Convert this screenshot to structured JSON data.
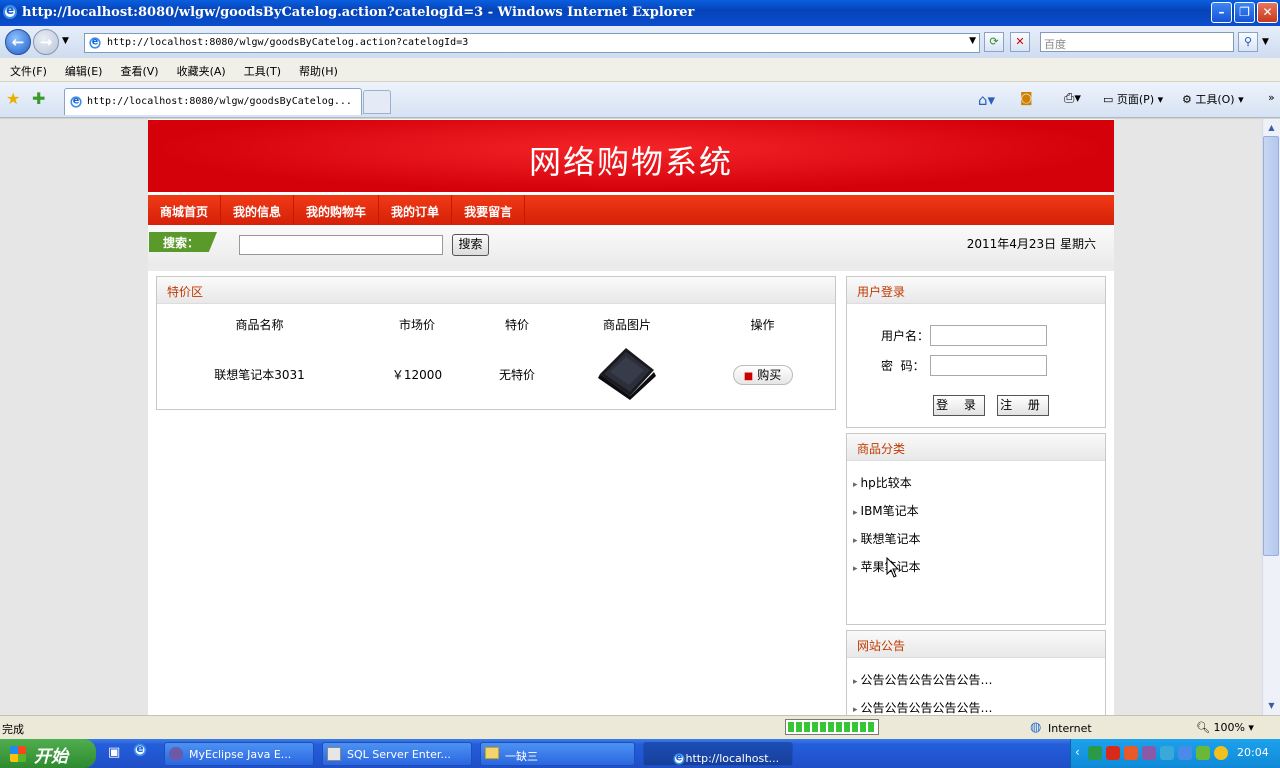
{
  "window": {
    "title": "http://localhost:8080/wlgw/goodsByCatelog.action?catelogId=3 - Windows Internet Explorer",
    "url": "http://localhost:8080/wlgw/goodsByCatelog.action?catelogId=3",
    "search_placeholder": "百度",
    "tab_title": "http://localhost:8080/wlgw/goodsByCatelog...",
    "menu": [
      "文件(F)",
      "编辑(E)",
      "查看(V)",
      "收藏夹(A)",
      "工具(T)",
      "帮助(H)"
    ],
    "tools": {
      "page": "页面(P)",
      "tools": "工具(O)"
    }
  },
  "site": {
    "banner_title": "网络购物系统",
    "nav": [
      "商城首页",
      "我的信息",
      "我的购物车",
      "我的订单",
      "我要留言"
    ],
    "search_label": "搜索：",
    "search_button": "搜索",
    "date": "2011年4月23日 星期六",
    "special": {
      "title": "特价区",
      "columns": [
        "商品名称",
        "市场价",
        "特价",
        "商品图片",
        "操作"
      ],
      "rows": [
        {
          "name": "联想笔记本3031",
          "market_price": "￥12000",
          "special_price": "无特价",
          "action": "购买"
        }
      ]
    },
    "login": {
      "title": "用户登录",
      "username_label": "用户名：",
      "password_label": "密  码：",
      "login_button": "登 录",
      "register_button": "注 册"
    },
    "categories": {
      "title": "商品分类",
      "items": [
        "hp比较本",
        "IBM笔记本",
        "联想笔记本",
        "苹果笔记本"
      ]
    },
    "notice": {
      "title": "网站公告",
      "items": [
        "公告公告公告公告公告…",
        "公告公告公告公告公告…"
      ]
    }
  },
  "statusbar": {
    "status": "完成",
    "zone": "Internet",
    "zoom": "100%"
  },
  "taskbar": {
    "start": "开始",
    "buttons": [
      "MyEclipse Java E...",
      "SQL Server Enter...",
      "一缺三",
      "http://localhost..."
    ],
    "clock": "20:04"
  }
}
